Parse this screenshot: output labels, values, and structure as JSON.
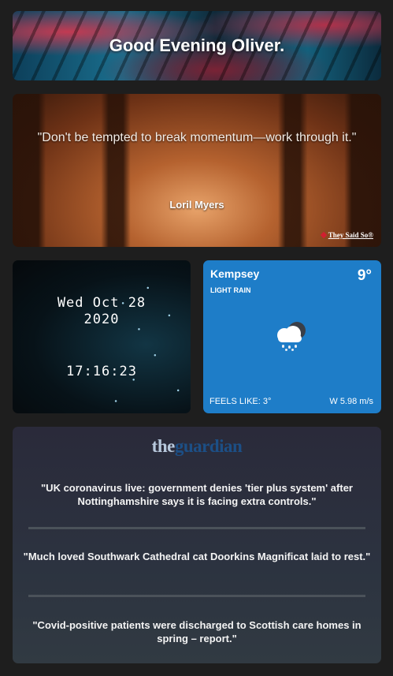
{
  "greeting": {
    "text": "Good Evening Oliver."
  },
  "quote": {
    "text": "\"Don't be tempted to break momentum—work through it.\"",
    "author": "Loril Myers",
    "credit": "They Said So®"
  },
  "clock": {
    "date_line1": "Wed Oct 28",
    "date_line2": "2020",
    "time": "17:16:23"
  },
  "weather": {
    "location": "Kempsey",
    "temperature": "9°",
    "condition": "LIGHT RAIN",
    "icon": "cloud-rain-icon",
    "feels_like": "FEELS LIKE: 3°",
    "wind": "W 5.98 m/s",
    "background_color": "#1e7dc8"
  },
  "news": {
    "logo_the": "the",
    "logo_guardian": "guardian",
    "items": [
      "\"UK coronavirus live: government denies 'tier plus system' after Nottinghamshire says it is facing extra controls.\"",
      "\"Much loved Southwark Cathedral cat Doorkins Magnificat laid to rest.\"",
      "\"Covid-positive patients were discharged to Scottish care homes in spring – report.\""
    ]
  }
}
